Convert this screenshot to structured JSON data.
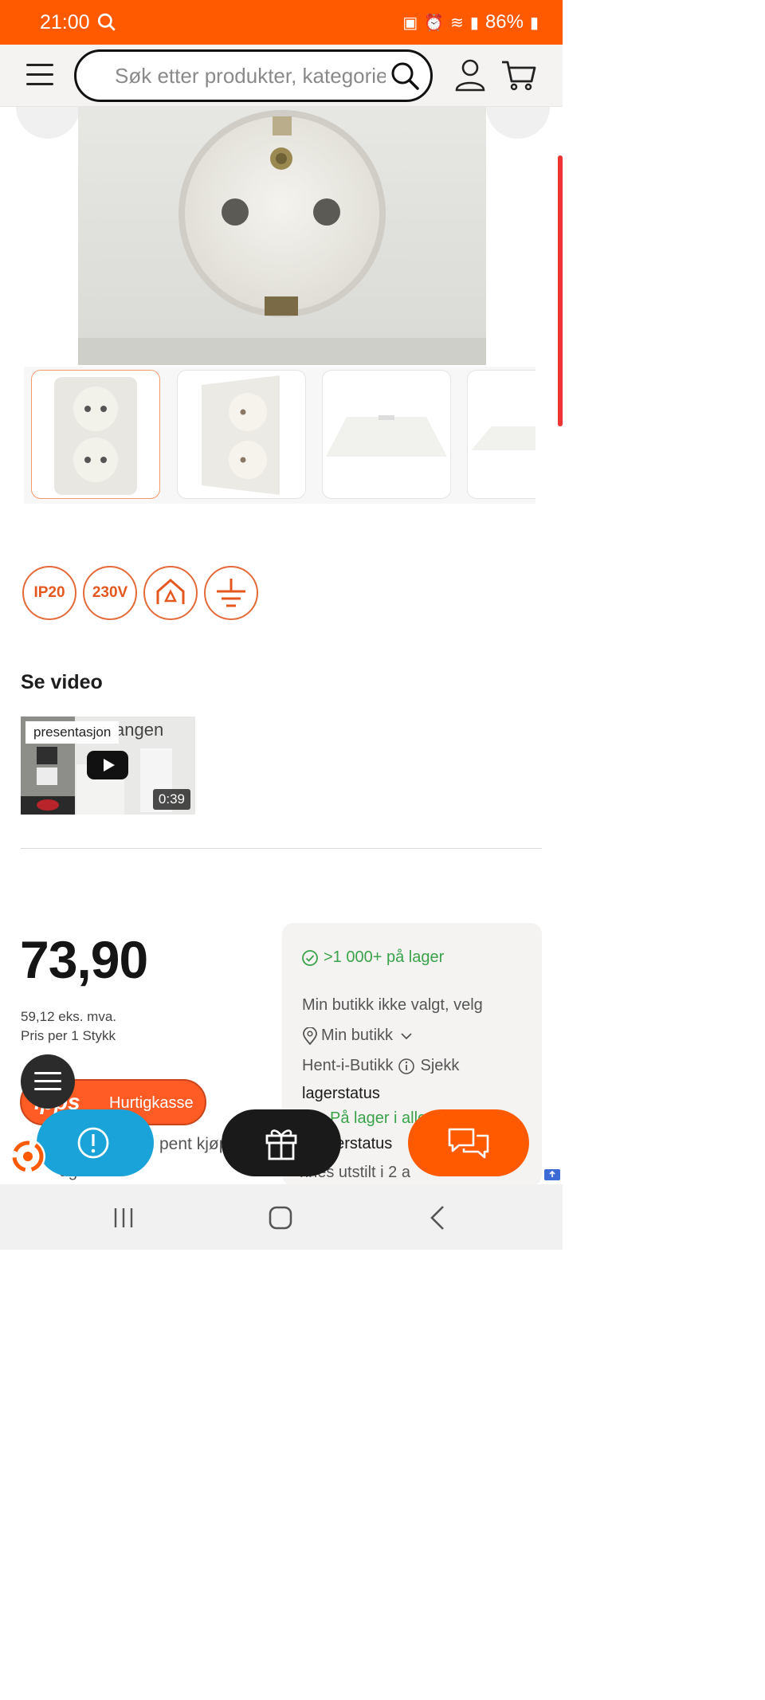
{
  "status_bar": {
    "time": "21:00",
    "battery": "86%"
  },
  "header": {
    "search_placeholder": "Søk etter produkter, kategorier"
  },
  "badges": [
    {
      "label": "IP20"
    },
    {
      "label": "230V"
    },
    {
      "label": "",
      "icon": "indoor-house-icon"
    },
    {
      "label": "",
      "icon": "ground-earth-icon"
    }
  ],
  "video": {
    "title": "Se video",
    "tag": "presentasjon",
    "background_word": "angen",
    "duration": "0:39"
  },
  "price": {
    "value": "73,90",
    "excl_vat": "59,12 eks. mva.",
    "per_unit": "Pris per 1 Stykk"
  },
  "stock": {
    "online": ">1 000+ på lager",
    "store_prompt": "Min butikk ikke valgt, velg",
    "store_link": "Min butikk",
    "pickup_label": "Hent-i-Butikk",
    "check_label": "Sjekk",
    "lagerstatus": "lagerstatus",
    "in_all": "På lager i alle",
    "lagerstatus2": "gerstatus",
    "shown": "nnes utstilt i 2 a"
  },
  "vipps": {
    "logo": "ipps",
    "label": "Hurtigkasse"
  },
  "open_buy": "pent kjøp",
  "cut_text": "ug tid",
  "colors": {
    "brand": "#ff5a00",
    "green": "#3aa24a",
    "badge": "#e4571f",
    "vipps": "#ff5b24",
    "alert": "#1aa3d8"
  }
}
